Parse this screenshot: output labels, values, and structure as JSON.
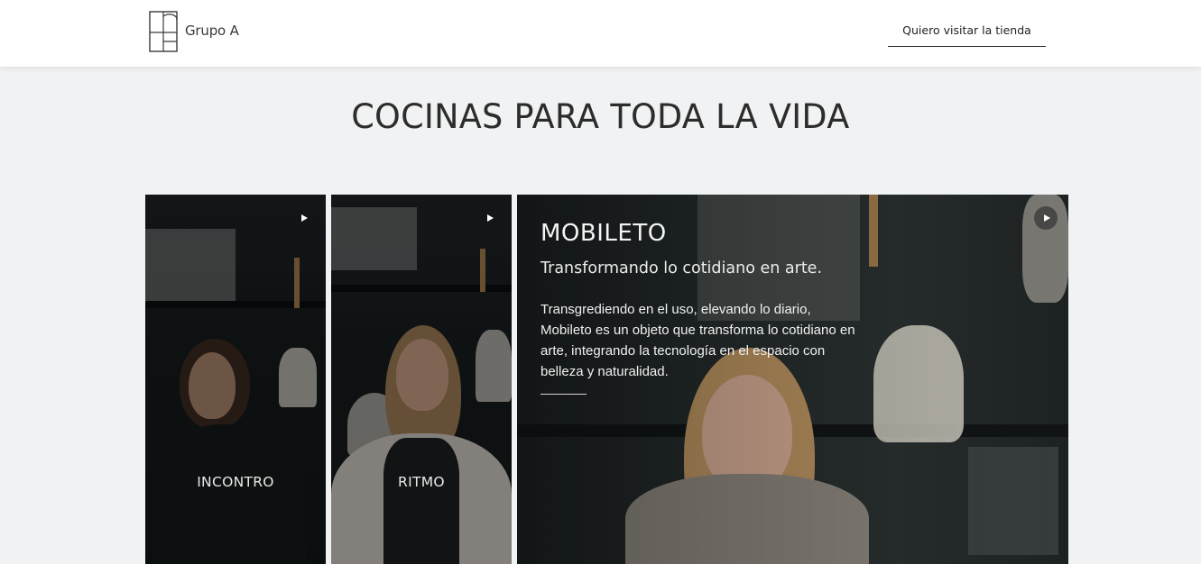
{
  "header": {
    "logo_text": "Grupo A",
    "visit_label": "Quiero visitar la tienda"
  },
  "page": {
    "title": "COCINAS PARA TODA LA VIDA"
  },
  "cards": [
    {
      "label": "INCONTRO"
    },
    {
      "label": "RITMO"
    }
  ],
  "featured": {
    "title": "MOBILETO",
    "subtitle": "Transformando lo cotidiano en arte.",
    "description": "Transgrediendo en el uso, elevando lo diario, Mobileto es un objeto que transforma lo cotidiano en arte, integrando la tecnología en el espacio con belleza y naturalidad."
  }
}
